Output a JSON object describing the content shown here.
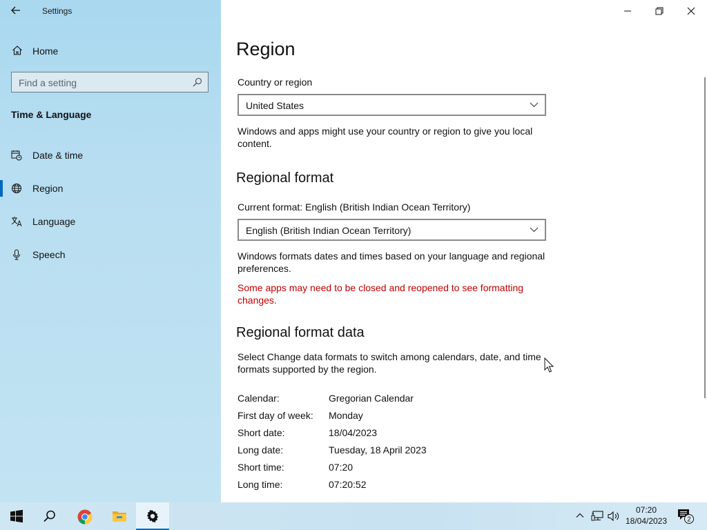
{
  "window": {
    "app_title": "Settings",
    "controls": [
      "minimize",
      "restore",
      "close"
    ]
  },
  "sidebar": {
    "home_label": "Home",
    "search_placeholder": "Find a setting",
    "section_title": "Time & Language",
    "items": [
      {
        "label": "Date & time",
        "icon": "calendar-clock-icon",
        "selected": false
      },
      {
        "label": "Region",
        "icon": "globe-icon",
        "selected": true
      },
      {
        "label": "Language",
        "icon": "language-icon",
        "selected": false
      },
      {
        "label": "Speech",
        "icon": "microphone-icon",
        "selected": false
      }
    ]
  },
  "main": {
    "title": "Region",
    "country": {
      "label": "Country or region",
      "value": "United States",
      "description": "Windows and apps might use your country or region to give you local content."
    },
    "regional_format": {
      "heading": "Regional format",
      "current_label": "Current format: English (British Indian Ocean Territory)",
      "value": "English (British Indian Ocean Territory)",
      "description": "Windows formats dates and times based on your language and regional preferences.",
      "warning": "Some apps may need to be closed and reopened to see formatting changes.",
      "warning_color": "#c00000"
    },
    "format_data": {
      "heading": "Regional format data",
      "description": "Select Change data formats to switch among calendars, date, and time formats supported by the region.",
      "rows": [
        {
          "key": "Calendar:",
          "value": "Gregorian Calendar"
        },
        {
          "key": "First day of week:",
          "value": "Monday"
        },
        {
          "key": "Short date:",
          "value": "18/04/2023"
        },
        {
          "key": "Long date:",
          "value": "Tuesday, 18 April 2023"
        },
        {
          "key": "Short time:",
          "value": "07:20"
        },
        {
          "key": "Long time:",
          "value": "07:20:52"
        }
      ]
    }
  },
  "taskbar": {
    "apps": [
      "start-icon",
      "search-icon",
      "chrome-icon",
      "file-explorer-icon",
      "settings-icon"
    ],
    "clock_time": "07:20",
    "clock_date": "18/04/2023",
    "notification_count": "2",
    "accent_color": "#0067c0"
  }
}
